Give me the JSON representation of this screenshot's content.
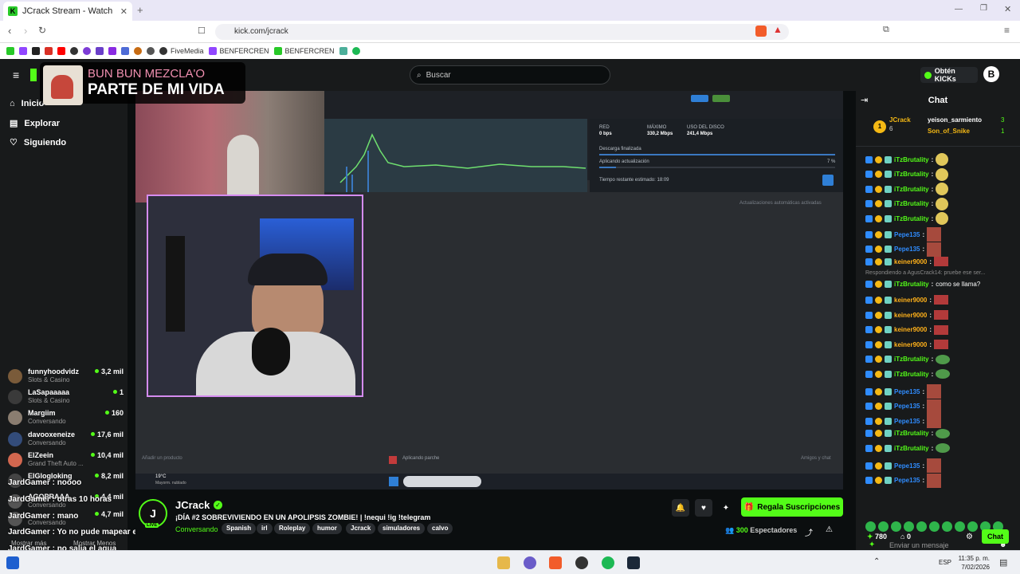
{
  "browser": {
    "tab_title": "JCrack Stream - Watch Live on K",
    "url": "kick.com/jcrack",
    "bookmarks": [
      "FiveMedia",
      "BENFERCREN",
      "BENFERCREN"
    ]
  },
  "nav": {
    "search_placeholder": "Buscar",
    "kicks_label": "Obtén KICKs",
    "avatar_letter": "B"
  },
  "sidebar": {
    "items": [
      {
        "label": "Inicio"
      },
      {
        "label": "Explorar"
      },
      {
        "label": "Siguiendo"
      }
    ],
    "channels": [
      {
        "name": "funnyhoodvidz",
        "category": "Slots & Casino",
        "viewers": "3,2 mil"
      },
      {
        "name": "LaSapaaaaa",
        "category": "Slots & Casino",
        "viewers": "1"
      },
      {
        "name": "Margiim",
        "category": "Conversando",
        "viewers": "160"
      },
      {
        "name": "davooxeneize",
        "category": "Conversando",
        "viewers": "17,6 mil"
      },
      {
        "name": "ElZeein",
        "category": "Grand Theft Auto ...",
        "viewers": "10,4 mil"
      },
      {
        "name": "ElGlogloking",
        "category": "",
        "viewers": "8,2 mil"
      },
      {
        "name": "AGOPRAAA",
        "category": "Conversando",
        "viewers": "4,4 mil"
      },
      {
        "name": "",
        "category": "Conversando",
        "viewers": "4,7 mil"
      }
    ],
    "show_more": "Mostrar más",
    "show_less": "Mostrar Menos"
  },
  "overlay": {
    "song_line1": "BUN BUN MEZCLA'O",
    "song_line2": "PARTE DE MI VIDA",
    "chat_lines": [
      "JardGamer : noooo",
      "JardGamer : otras 10 horas",
      "JardGamer : mano",
      "JardGamer : Yo no pude mapear en ese porqueria",
      "JardGamer : no salia el agua"
    ]
  },
  "stream": {
    "channel": "JCrack",
    "title": "¡DÍA #2 SOBREVIVIENDO EN UN APOLIPSIS ZOMBIE! | !nequi !ig !telegram",
    "category": "Conversando",
    "live": "LIVE",
    "tags": [
      "Spanish",
      "irl",
      "Roleplay",
      "humor",
      "Jcrack",
      "simuladores",
      "calvo"
    ],
    "subs_button": "Regala Suscripciones",
    "viewers_count": "300",
    "viewers_label": "Espectadores"
  },
  "screen": {
    "dl_finished": "Descarga finalizada",
    "applying": "Aplicando actualización",
    "time_left": "Tiempo restante estimado: 18:09",
    "red": "RED",
    "red_val": "0 bps",
    "max": "MÁXIMO",
    "max_val": "330,2 Mbps",
    "disk": "USO DEL DISCO",
    "disk_val": "241,4 Mbps",
    "auto": "Actualizaciones automáticas activadas",
    "pct": "7 %",
    "add_product": "Añadir un producto",
    "applying_short": "Aplicando parche",
    "friends": "Amigos y chat",
    "temp": "19°C",
    "weather": "Mayorm. nublado"
  },
  "chat": {
    "header": "Chat",
    "gifters": [
      {
        "name": "JCrack",
        "count": "6"
      },
      {
        "name": "yeison_sarmiento",
        "count": "3"
      },
      {
        "name": "Son_of_Snike",
        "count": "1"
      }
    ],
    "messages": [
      {
        "user": "iTzBrutality",
        "text": "",
        "color": "#53fc18",
        "emote": "face"
      },
      {
        "user": "iTzBrutality",
        "text": "",
        "color": "#53fc18",
        "emote": "face"
      },
      {
        "user": "iTzBrutality",
        "text": "",
        "color": "#53fc18",
        "emote": "face"
      },
      {
        "user": "iTzBrutality",
        "text": "",
        "color": "#53fc18",
        "emote": "face"
      },
      {
        "user": "iTzBrutality",
        "text": "",
        "color": "#53fc18",
        "emote": "face"
      },
      {
        "user": "Pepe135",
        "text": "",
        "color": "#2f8cff",
        "emote": "pic"
      },
      {
        "user": "Pepe135",
        "text": "",
        "color": "#2f8cff",
        "emote": "pic"
      },
      {
        "user": "keiner9000",
        "text": "",
        "color": "#ffb11a",
        "emote": "pic2"
      },
      {
        "user": "iTzBrutality",
        "text": "como se llama?",
        "color": "#53fc18",
        "emote": "",
        "reply": "Respondiendo a AgusCrack14: pruebe ese ser..."
      },
      {
        "user": "keiner9000",
        "text": "",
        "color": "#ffb11a",
        "emote": "pic2"
      },
      {
        "user": "keiner9000",
        "text": "",
        "color": "#ffb11a",
        "emote": "pic2"
      },
      {
        "user": "keiner9000",
        "text": "",
        "color": "#ffb11a",
        "emote": "pic2"
      },
      {
        "user": "keiner9000",
        "text": "",
        "color": "#ffb11a",
        "emote": "pic2"
      },
      {
        "user": "iTzBrutality",
        "text": "",
        "color": "#53fc18",
        "emote": "frog"
      },
      {
        "user": "iTzBrutality",
        "text": "",
        "color": "#53fc18",
        "emote": "frog"
      },
      {
        "user": "Pepe135",
        "text": "",
        "color": "#2f8cff",
        "emote": "pic"
      },
      {
        "user": "Pepe135",
        "text": "",
        "color": "#2f8cff",
        "emote": "pic"
      },
      {
        "user": "Pepe135",
        "text": "",
        "color": "#2f8cff",
        "emote": "pic"
      },
      {
        "user": "iTzBrutality",
        "text": "",
        "color": "#53fc18",
        "emote": "frog"
      },
      {
        "user": "iTzBrutality",
        "text": "",
        "color": "#53fc18",
        "emote": "frog"
      },
      {
        "user": "Pepe135",
        "text": "",
        "color": "#2f8cff",
        "emote": "pic"
      },
      {
        "user": "Pepe135",
        "text": "",
        "color": "#2f8cff",
        "emote": "pic"
      }
    ],
    "input_placeholder": "Enviar un mensaje",
    "kicks_count": "780",
    "other_count": "0",
    "chat_button": "Chat"
  },
  "taskbar": {
    "lang": "ESP",
    "time": "11:35 p. m.",
    "date": "7/02/2026"
  },
  "colors": {
    "accent": "#53fc18",
    "bg": "#0b0e0f",
    "panel": "#181a1b"
  }
}
